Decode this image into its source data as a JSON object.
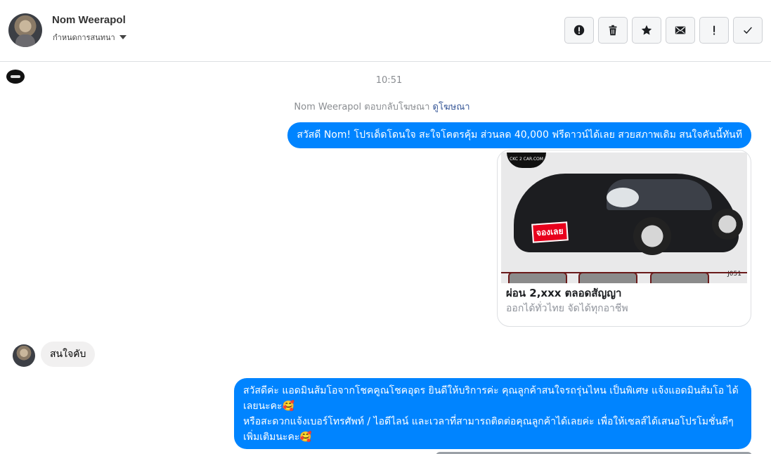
{
  "header": {
    "contact_name": "Nom Weerapol",
    "assign_label": "กำหนดการสนทนา",
    "toolbar": [
      {
        "name": "mark-spam-button",
        "icon": "alert-circle-icon"
      },
      {
        "name": "delete-button",
        "icon": "trash-icon"
      },
      {
        "name": "star-button",
        "icon": "star-icon"
      },
      {
        "name": "mark-unread-button",
        "icon": "envelope-icon"
      },
      {
        "name": "follow-up-button",
        "icon": "exclamation-icon"
      },
      {
        "name": "mark-done-button",
        "icon": "check-icon"
      }
    ]
  },
  "conversation": {
    "timestamp": "10:51",
    "ad_reply_text": "Nom Weerapol ตอบกลับโฆษณา",
    "view_ad_link": "ดูโฆษณา",
    "message_1": "สวัสดี Nom! โปรเด็ดโดนใจ สะใจโคตรคุ้ม ส่วนลด 40,000 ฟรีดาวน์ได้เลย สวยสภาพเดิม สนใจคันนี้ทันที",
    "card": {
      "image_logo": "CKC 2 CAR.COM",
      "image_tag": "จองเลย",
      "image_code": "J051",
      "title": "ผ่อน 2,xxx ตลอดสัญญา",
      "subtitle": "ออกได้ทั่วไทย จัดได้ทุกอาชีพ"
    },
    "incoming_message": "สนใจคับ",
    "message_2_line_1": "สวัสดีค่ะ แอดมินส้มโอจากโชคคูณโชคอุดร ยินดีให้บริการค่ะ   คุณลูกค้าสนใจรถรุ่นไหน เป็นพิเศษ แจ้งแอดมินส้มโอ ได้เลยนะคะ🥰",
    "message_2_line_2": "หรือสะดวกแจ้งเบอร์โทรศัพท์ / ไอดีไลน์ และเวลาที่สามารถติดต่อคุณลูกค้าได้เลยค่ะ เพื่อให้เซลส์ได้เสนอโปรโมชั่นดีๆเพิ่มเติมนะคะ🥰"
  },
  "colors": {
    "outgoing_bubble": "#0084ff",
    "incoming_bubble": "#f1f0f0",
    "link": "#385898",
    "muted_text": "#8a8d91"
  }
}
